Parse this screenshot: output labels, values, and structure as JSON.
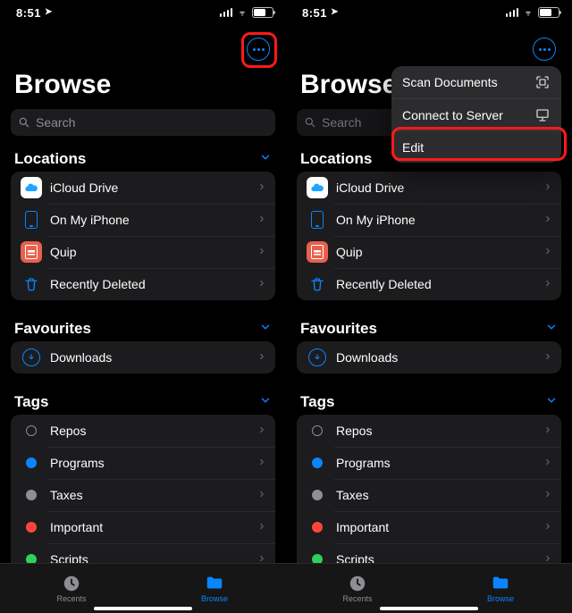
{
  "status": {
    "time": "8:51"
  },
  "title": "Browse",
  "search": {
    "placeholder": "Search"
  },
  "sections": {
    "locations": {
      "header": "Locations",
      "items": [
        {
          "label": "iCloud Drive"
        },
        {
          "label": "On My iPhone"
        },
        {
          "label": "Quip"
        },
        {
          "label": "Recently Deleted"
        }
      ]
    },
    "favourites": {
      "header": "Favourites",
      "items": [
        {
          "label": "Downloads"
        }
      ]
    },
    "tags": {
      "header": "Tags",
      "items": [
        {
          "label": "Repos"
        },
        {
          "label": "Programs"
        },
        {
          "label": "Taxes"
        },
        {
          "label": "Important"
        },
        {
          "label": "Scripts"
        }
      ]
    }
  },
  "tabs": {
    "recents": "Recents",
    "browse": "Browse"
  },
  "menu": {
    "scan": "Scan Documents",
    "connect": "Connect to Server",
    "edit": "Edit"
  }
}
